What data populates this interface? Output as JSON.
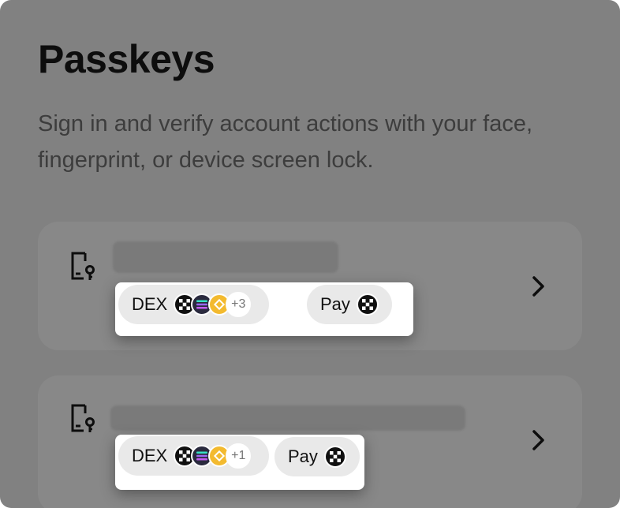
{
  "page": {
    "title": "Passkeys",
    "subtitle": "Sign in and verify account actions with your face, fingerprint, or device screen lock."
  },
  "passkeys": [
    {
      "dex_label": "DEX",
      "dex_coins": [
        "okx-icon",
        "solana-icon",
        "bnb-icon"
      ],
      "dex_more": "+3",
      "pay_label": "Pay",
      "pay_coin": "okx-icon"
    },
    {
      "dex_label": "DEX",
      "dex_coins": [
        "okx-icon",
        "solana-icon",
        "bnb-icon"
      ],
      "dex_more": "+1",
      "pay_label": "Pay",
      "pay_coin": "okx-icon"
    }
  ],
  "colors": {
    "overlay": "#818181",
    "card": "#888888",
    "pill": "#e9e9e9",
    "bnb": "#f3ba2f"
  }
}
